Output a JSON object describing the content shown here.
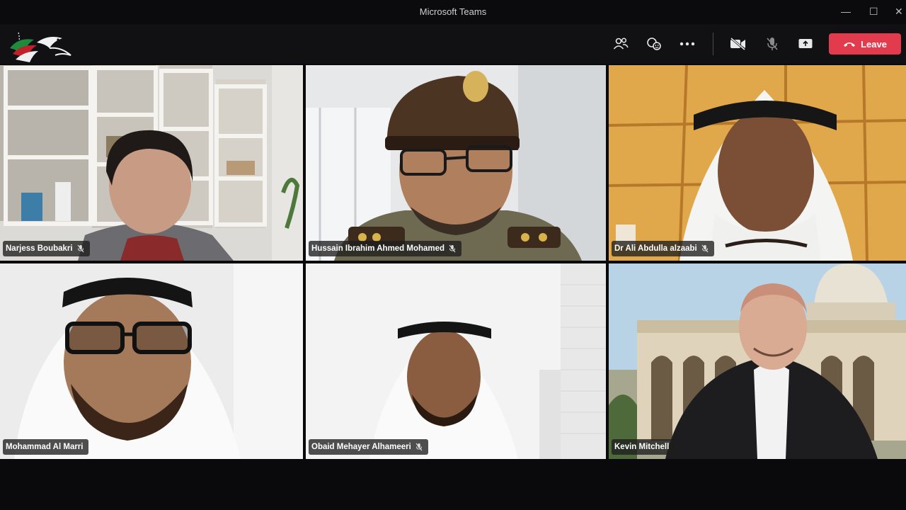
{
  "window": {
    "title": "Microsoft Teams"
  },
  "toolbar": {
    "leave_label": "Leave"
  },
  "participants": [
    {
      "name": "Narjess Boubakri",
      "muted": true
    },
    {
      "name": "Hussain Ibrahim Ahmed Mohamed",
      "muted": true
    },
    {
      "name": "Dr Ali Abdulla alzaabi",
      "muted": true
    },
    {
      "name": "Mohammad Al Marri",
      "muted": false
    },
    {
      "name": "Obaid Mehayer Alhameeri",
      "muted": true
    },
    {
      "name": "Kevin Mitchell",
      "muted": false
    }
  ],
  "colors": {
    "leave": "#e23b4e",
    "background": "#0a0a0c",
    "toolbar": "#111114"
  }
}
